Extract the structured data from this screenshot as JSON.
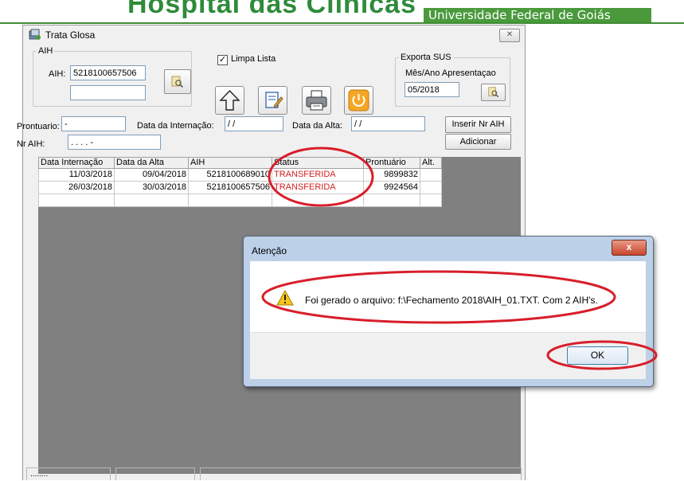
{
  "banner": {
    "title": "Hospital das Clínicas",
    "subtitle": "Universidade Federal de Goiás"
  },
  "window": {
    "title": "Trata Glosa",
    "aih_group": {
      "legend": "AIH",
      "aih_label": "AIH:",
      "aih_value": "5218100657506",
      "second_field_value": ""
    },
    "limpa_lista": {
      "label": "Limpa Lista",
      "checked": true
    },
    "exporta_group": {
      "legend": "Exporta SUS",
      "label": "Mês/Ano Apresentaçao",
      "value": "05/2018"
    },
    "fields": {
      "prontuario_label": "Prontuario:",
      "prontuario_value": "      -",
      "data_internacao_label": "Data da Internação:",
      "data_internacao_value": " / /",
      "data_alta_label": "Data da Alta:",
      "data_alta_value": " / /",
      "nr_aih_label": "Nr AIH:",
      "nr_aih_value": " .  .  .  .  -"
    },
    "buttons": {
      "inserir": "Inserir Nr AIH",
      "adicionar": "Adicionar"
    },
    "table": {
      "columns": [
        "Data Internação",
        "Data da Alta",
        "AIH",
        "Status",
        "Prontuário",
        "Alt."
      ],
      "rows": [
        [
          "11/03/2018",
          "09/04/2018",
          "5218100689010",
          "TRANSFERIDA",
          "9899832",
          ""
        ],
        [
          "26/03/2018",
          "30/03/2018",
          "5218100657506",
          "TRANSFERIDA",
          "9924564",
          ""
        ]
      ]
    },
    "status_bar": {
      "panel1": "........"
    }
  },
  "dialog": {
    "title": "Atenção",
    "close_label": "x",
    "message": "Foi gerado o arquivo: f:\\Fechamento 2018\\AIH_01.TXT. Com 2 AIH's.",
    "ok_label": "OK"
  },
  "colors": {
    "annotation": "#d81e2a",
    "status_text": "#d42020",
    "banner_green": "#4a9a3c"
  },
  "icons": [
    "app-icon",
    "search-icon",
    "arrow-up-icon",
    "edit-icon",
    "printer-icon",
    "power-icon",
    "warning-icon",
    "close-icon"
  ]
}
